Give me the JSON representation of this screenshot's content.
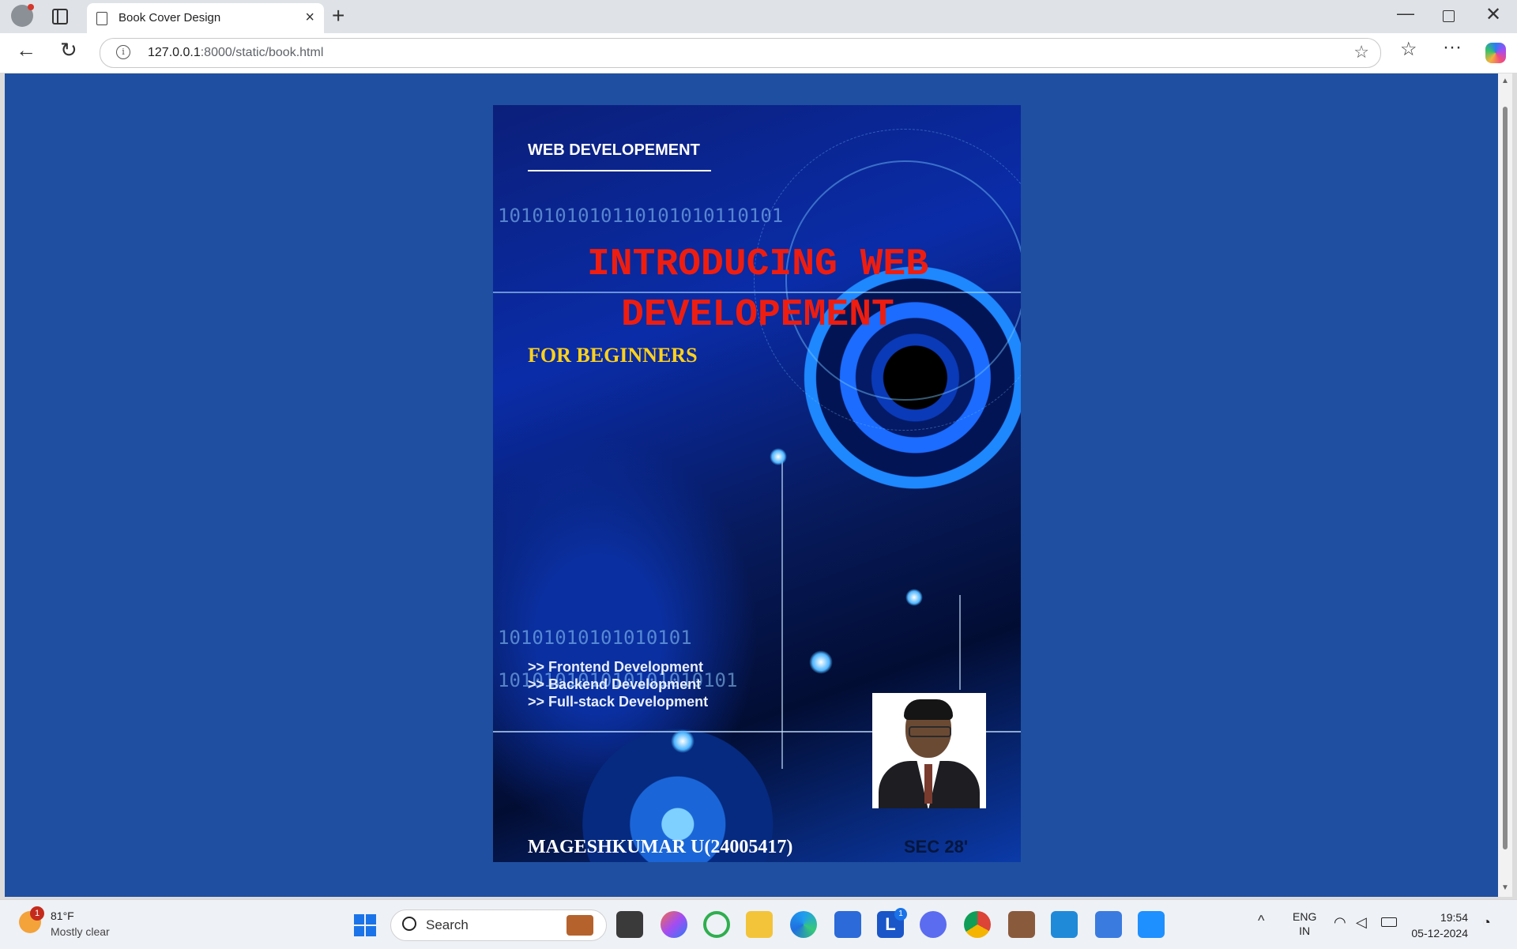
{
  "browser": {
    "tab_title": "Book Cover Design",
    "url_host": "127.0.0.1",
    "url_rest": ":8000/static/book.html"
  },
  "cover": {
    "series_title": "WEB DEVELOPEMENT",
    "title_line1": "INTRODUCING WEB",
    "title_line2": "DEVELOPEMENT",
    "subtitle": "FOR BEGINNERS",
    "binary_1": "1010101010110101010110101",
    "binary_2": "10101010101010101",
    "binary_3": "101010101010101010101",
    "topics": [
      ">> Frontend Development",
      ">> Backend Development",
      ">> Full-stack Development"
    ],
    "author": "MAGESHKUMAR U(24005417)",
    "section": "SEC 28'"
  },
  "taskbar": {
    "weather_badge": "1",
    "weather_temp": "81°F",
    "weather_desc": "Mostly clear",
    "search_label": "Search",
    "app_badge": "1",
    "lang_1": "ENG",
    "lang_2": "IN",
    "time": "19:54",
    "date": "05-12-2024"
  },
  "colors": {
    "page_background": "#1f4fa0",
    "title_red": "#ee1d10",
    "subtitle_yellow": "#ffd21a"
  }
}
